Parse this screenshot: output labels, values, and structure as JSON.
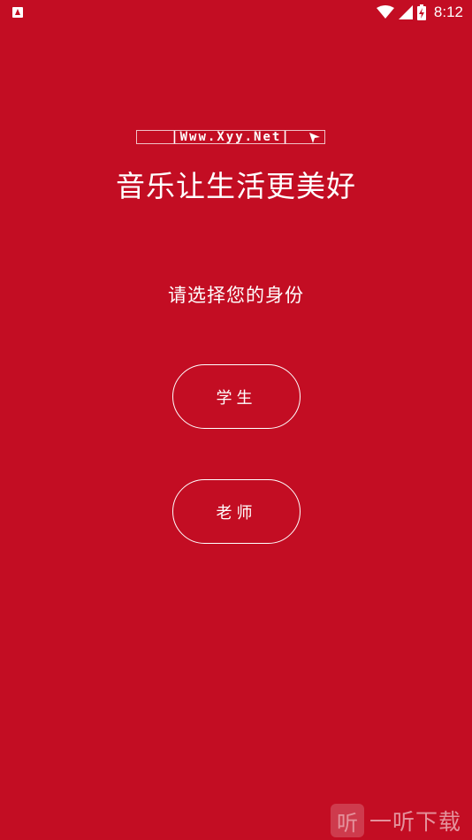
{
  "status_bar": {
    "time": "8:12"
  },
  "splash": {
    "watermark": "|Www.Xyy.Net|",
    "slogan": "音乐让生活更美好"
  },
  "role_selection": {
    "prompt": "请选择您的身份",
    "student_label": "学生",
    "teacher_label": "老师"
  },
  "watermark_logo": {
    "mark": "听",
    "name": "一听下载"
  },
  "colors": {
    "background": "#c30d23",
    "foreground": "#ffffff"
  }
}
